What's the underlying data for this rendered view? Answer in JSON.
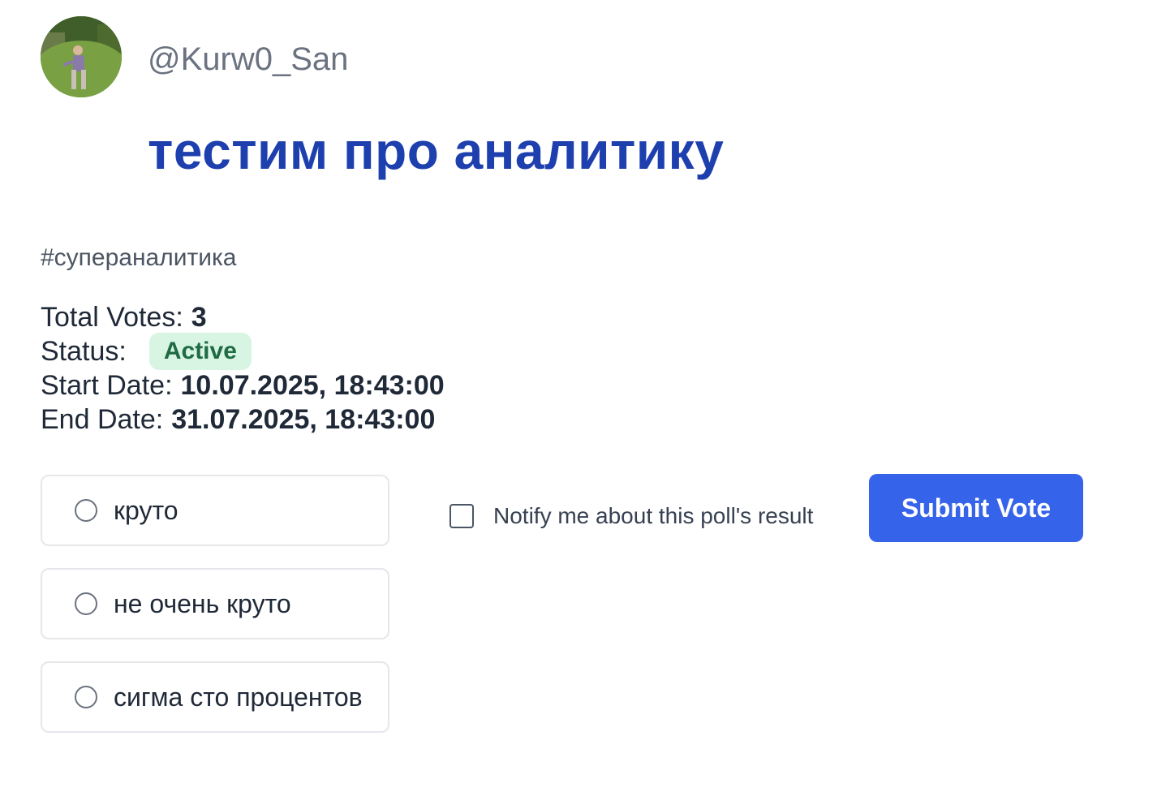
{
  "author": {
    "username": "@Kurw0_San",
    "avatar_icon": "user-avatar-photo"
  },
  "poll": {
    "title": "тестим про аналитику",
    "hashtag": "#супераналитика"
  },
  "info": {
    "total_votes_label": "Total Votes:",
    "total_votes_value": "3",
    "status_label": "Status:",
    "status_value": "Active",
    "start_date_label": "Start Date:",
    "start_date_value": "10.07.2025, 18:43:00",
    "end_date_label": "End Date:",
    "end_date_value": "31.07.2025, 18:43:00"
  },
  "options": [
    {
      "label": "круто",
      "selected": false
    },
    {
      "label": "не очень круто",
      "selected": false
    },
    {
      "label": "сигма сто процентов",
      "selected": false
    }
  ],
  "notify": {
    "label": "Notify me about this poll's result",
    "checked": false
  },
  "actions": {
    "submit_label": "Submit Vote"
  },
  "colors": {
    "title": "#1e3fae",
    "submit_button": "#3563e9",
    "status_badge_bg": "#d8f5e4",
    "status_badge_text": "#1f6b43"
  }
}
